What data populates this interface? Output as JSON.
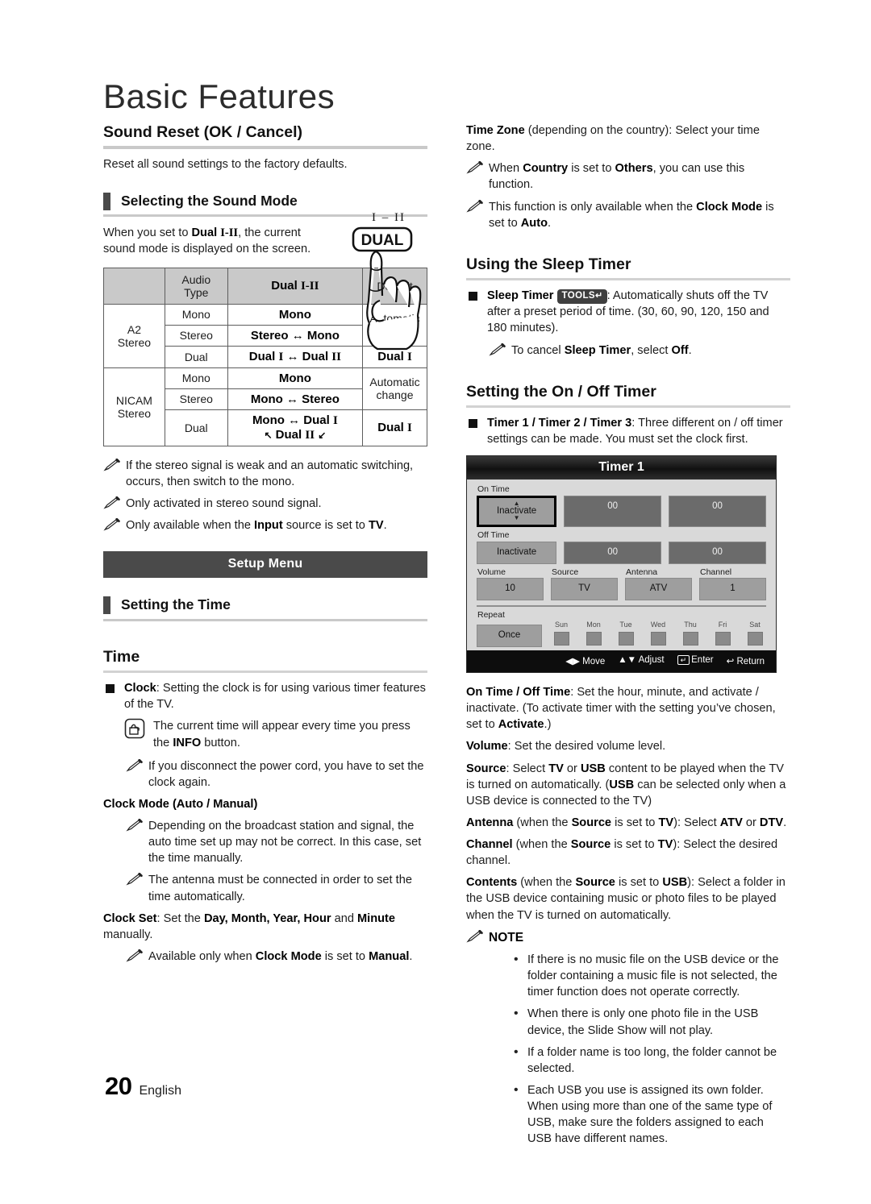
{
  "page": {
    "title": "Basic Features",
    "footer_number": "20",
    "footer_lang": "English"
  },
  "left": {
    "sound_reset": {
      "heading": "Sound Reset (OK / Cancel)",
      "body": "Reset all sound settings to the factory defaults."
    },
    "sound_mode": {
      "heading": "Selecting the Sound Mode",
      "intro_1": "When you set to ",
      "intro_bold": "Dual ",
      "intro_roman": "I-II",
      "intro_2": ", the current sound mode is displayed on the screen.",
      "figure_top_label": "I – II",
      "figure_button_label": "DUAL"
    },
    "audio_table": {
      "headers": [
        "",
        "Audio Type",
        "Dual I-II",
        "Default"
      ],
      "rows": [
        {
          "system": "A2 Stereo",
          "type": "Mono",
          "dual": "Mono",
          "default": "Automatic change"
        },
        {
          "system": "A2 Stereo",
          "type": "Stereo",
          "dual": "Stereo ↔ Mono",
          "default": "Automatic change"
        },
        {
          "system": "A2 Stereo",
          "type": "Dual",
          "dual": "Dual I ↔ Dual II",
          "default": "Dual I"
        },
        {
          "system": "NICAM Stereo",
          "type": "Mono",
          "dual": "Mono",
          "default": "Automatic change"
        },
        {
          "system": "NICAM Stereo",
          "type": "Stereo",
          "dual": "Mono ↔ Stereo",
          "default": "Automatic change"
        },
        {
          "system": "NICAM Stereo",
          "type": "Dual",
          "dual": "Mono ↔ Dual I ↖ Dual II ↙",
          "default": "Dual I"
        }
      ],
      "cells": {
        "sys_a2": "A2 Stereo",
        "sys_nicam": "NICAM Stereo",
        "type_mono": "Mono",
        "type_stereo": "Stereo",
        "type_dual": "Dual",
        "dual_mono": "Mono",
        "dual_stereo_mono": "Stereo ↔ Mono",
        "dual_mono_stereo": "Mono ↔ Stereo",
        "auto_change": "Automatic change"
      }
    },
    "notes": [
      "If the stereo signal is weak and an automatic switching, occurs, then switch to the mono.",
      "Only activated in stereo sound signal.",
      "Only available when the Input source is set to TV."
    ],
    "setup_menu_bar": "Setup Menu",
    "setting_the_time": {
      "heading": "Setting the Time",
      "time_heading": "Time",
      "clock_label": "Clock",
      "clock_text": ": Setting the clock is for using various timer features of the TV.",
      "info_note_1": "The current time will appear every time you press the ",
      "info_note_bold": "INFO",
      "info_note_2": " button.",
      "power_note": "If you disconnect the power cord, you have to set the clock again.",
      "clock_mode_heading": "Clock Mode (Auto / Manual)",
      "clock_mode_note_1": "Depending on the broadcast station and signal, the auto time set up may not be correct. In this case, set the time manually.",
      "clock_mode_note_2": "The antenna must be connected in order to set the time automatically.",
      "clock_set_label": "Clock Set",
      "clock_set_text_1": ": Set the ",
      "clock_set_bold": "Day, Month, Year, Hour",
      "clock_set_text_2": " and ",
      "clock_set_bold2": "Minute",
      "clock_set_text_3": " manually.",
      "clock_set_note_1": "Available only when ",
      "clock_set_note_bold": "Clock Mode",
      "clock_set_note_2": " is set to ",
      "clock_set_note_bold2": "Manual",
      "clock_set_note_3": "."
    }
  },
  "right": {
    "time_zone": {
      "label": "Time Zone",
      "text": " (depending on the country): Select your time zone.",
      "note_1_a": "When ",
      "note_1_b": "Country",
      "note_1_c": " is set to ",
      "note_1_d": "Others",
      "note_1_e": ", you can use this function.",
      "note_2_a": "This function is only available when the ",
      "note_2_b": "Clock Mode",
      "note_2_c": " is set to ",
      "note_2_d": "Auto",
      "note_2_e": "."
    },
    "sleep_timer": {
      "heading": "Using the Sleep Timer",
      "label": "Sleep Timer",
      "badge": "TOOLS",
      "badge_arrow": "↵",
      "text": ": Automatically shuts off the TV after a preset period of time. (30, 60, 90, 120, 150 and 180 minutes).",
      "note_a": "To cancel ",
      "note_b": "Sleep Timer",
      "note_c": ", select ",
      "note_d": "Off",
      "note_e": "."
    },
    "on_off_timer": {
      "heading": "Setting the On / Off Timer",
      "timers_label": "Timer 1 / Timer 2 / Timer 3",
      "timers_text": ": Three different on / off timer settings can be made. You must set the clock first."
    },
    "osd": {
      "title": "Timer 1",
      "on_time_label": "On Time",
      "on_time_state": "Inactivate",
      "on_time_hour": "00",
      "on_time_minute": "00",
      "off_time_label": "Off Time",
      "off_time_state": "Inactivate",
      "off_time_hour": "00",
      "off_time_minute": "00",
      "volume_label": "Volume",
      "volume_value": "10",
      "source_label": "Source",
      "source_value": "TV",
      "antenna_label": "Antenna",
      "antenna_value": "ATV",
      "channel_label": "Channel",
      "channel_value": "1",
      "repeat_label": "Repeat",
      "repeat_value": "Once",
      "days": [
        "Sun",
        "Mon",
        "Tue",
        "Wed",
        "Thu",
        "Fri",
        "Sat"
      ],
      "footer": {
        "move": "Move",
        "adjust": "Adjust",
        "enter": "Enter",
        "return": "Return",
        "enter_key": "↵"
      }
    },
    "descriptions": {
      "on_off_label": "On Time / Off Time",
      "on_off_text_1": ": Set the hour, minute, and activate / inactivate. (To activate timer with the setting you’ve chosen, set to ",
      "on_off_bold": "Activate",
      "on_off_text_2": ".)",
      "volume_label": "Volume",
      "volume_text": ": Set the desired volume level.",
      "source_label": "Source",
      "source_text_1": ": Select ",
      "source_b1": "TV",
      "source_text_2": " or ",
      "source_b2": "USB",
      "source_text_3": " content to be played when the TV is turned on automatically. (",
      "source_b3": "USB",
      "source_text_4": " can be selected only when a USB device is connected to the TV)",
      "antenna_label": "Antenna",
      "antenna_text_1": " (when the ",
      "antenna_b1": "Source",
      "antenna_text_2": " is set to ",
      "antenna_b2": "TV",
      "antenna_text_3": "): Select ",
      "antenna_b3": "ATV",
      "antenna_text_4": " or ",
      "antenna_b4": "DTV",
      "antenna_text_5": ".",
      "channel_label": "Channel",
      "channel_text_1": " (when the ",
      "channel_b1": "Source",
      "channel_text_2": " is set to ",
      "channel_b2": "TV",
      "channel_text_3": "): Select the desired channel.",
      "contents_label": "Contents",
      "contents_text_1": " (when the ",
      "contents_b1": "Source",
      "contents_text_2": " is set to ",
      "contents_b2": "USB",
      "contents_text_3": "): Select a folder in the USB device containing music or photo files to be played when the TV is turned on automatically."
    },
    "note_heading": "NOTE",
    "note_bullets": [
      "If there is no music file on the USB device or the folder containing a music file is not selected, the timer function does not operate correctly.",
      "When there is only one photo file in the USB device, the Slide Show will not play.",
      "If a folder name is too long, the folder cannot be selected.",
      "Each USB you use is assigned its own folder. When using more than one of the same type of USB, make sure the folders assigned to each USB have different names."
    ]
  }
}
